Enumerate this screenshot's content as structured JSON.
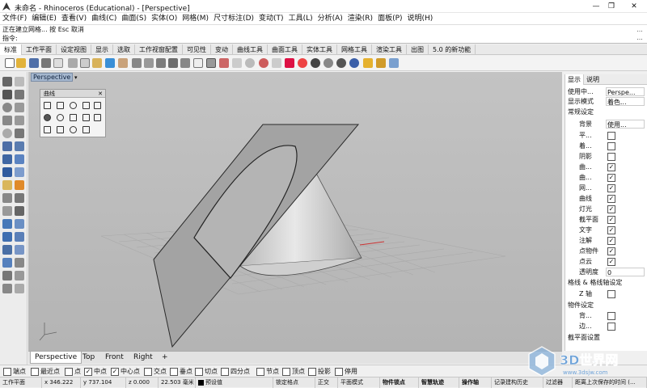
{
  "window": {
    "title": "未命名 - Rhinoceros (Educational) - [Perspective]",
    "controls": [
      "—",
      "❐",
      "✕"
    ]
  },
  "menu": [
    "文件(F)",
    "编辑(E)",
    "查看(V)",
    "曲线(C)",
    "曲面(S)",
    "实体(O)",
    "网格(M)",
    "尺寸标注(D)",
    "变动(T)",
    "工具(L)",
    "分析(A)",
    "渲染(R)",
    "面板(P)",
    "说明(H)"
  ],
  "command": {
    "history": "正在建立网格... 按 Esc 取消",
    "prompt": "指令:",
    "value": "",
    "side_buttons": [
      "…",
      "…"
    ]
  },
  "tabs": [
    "标准",
    "工作平面",
    "设定视图",
    "显示",
    "选取",
    "工作视窗配置",
    "可见性",
    "变动",
    "曲线工具",
    "曲面工具",
    "实体工具",
    "网格工具",
    "渲染工具",
    "出图",
    "5.0 的新功能"
  ],
  "viewport": {
    "label": "Perspective",
    "arrow": "▾"
  },
  "float_panel": {
    "title": "曲线"
  },
  "viewport_tabs": [
    "Perspective",
    "Top",
    "Front",
    "Right",
    "+"
  ],
  "right_panel": {
    "tabs": [
      "显示",
      "说明"
    ],
    "rows": [
      {
        "label": "使用中...",
        "value": "Perspe..."
      },
      {
        "label": "显示模式",
        "value": "着色..."
      },
      {
        "label": "常规设定",
        "value": ""
      },
      {
        "label": "背景",
        "value": "使用..."
      },
      {
        "label": "平...",
        "check": false
      },
      {
        "label": "着...",
        "check": false
      },
      {
        "label": "阴影",
        "check": false
      },
      {
        "label": "曲...",
        "check": true
      },
      {
        "label": "曲...",
        "check": true
      },
      {
        "label": "网...",
        "check": true
      },
      {
        "label": "曲线",
        "check": true
      },
      {
        "label": "灯光",
        "check": true
      },
      {
        "label": "截平面",
        "check": true
      },
      {
        "label": "文字",
        "check": true
      },
      {
        "label": "注解",
        "check": true
      },
      {
        "label": "点物件",
        "check": true
      },
      {
        "label": "点云",
        "check": true
      },
      {
        "label": "透明度",
        "value": "0"
      },
      {
        "label": "格线 & 格线轴设定",
        "value": ""
      },
      {
        "label": "Z 轴",
        "check": false
      },
      {
        "label": "物件设定",
        "value": ""
      },
      {
        "label": "背...",
        "check": false
      },
      {
        "label": "边...",
        "check": false
      },
      {
        "label": "截平面设置",
        "value": ""
      }
    ]
  },
  "osnaps": [
    {
      "label": "端点",
      "on": false
    },
    {
      "label": "最近点",
      "on": false
    },
    {
      "label": "点",
      "on": false
    },
    {
      "label": "中点",
      "on": true
    },
    {
      "label": "中心点",
      "on": true
    },
    {
      "label": "交点",
      "on": false
    },
    {
      "label": "垂点",
      "on": false
    },
    {
      "label": "切点",
      "on": false
    },
    {
      "label": "四分点",
      "on": false
    },
    {
      "label": "节点",
      "on": false
    },
    {
      "label": "顶点",
      "on": false
    },
    {
      "label": "投影",
      "on": false
    },
    {
      "label": "停用",
      "on": false
    }
  ],
  "status": [
    "工作平面",
    "x 346.222",
    "y 737.104",
    "z 0.000",
    "22.503 毫米",
    "预设值",
    "锁定格点",
    "正交",
    "平面模式",
    "物件锁点",
    "智慧轨迹",
    "操作轴",
    "记录建构历史",
    "过滤器",
    "距离上次保存的时间 (..."
  ],
  "watermark": {
    "text": "3D世界网",
    "sub": "www.3dsjw.com"
  },
  "colors": {
    "viewport_bg": "#bdbdbd",
    "surface": "#a0a0a0",
    "cone": "#d6d6d6",
    "label_bg": "#a6b8cf"
  }
}
